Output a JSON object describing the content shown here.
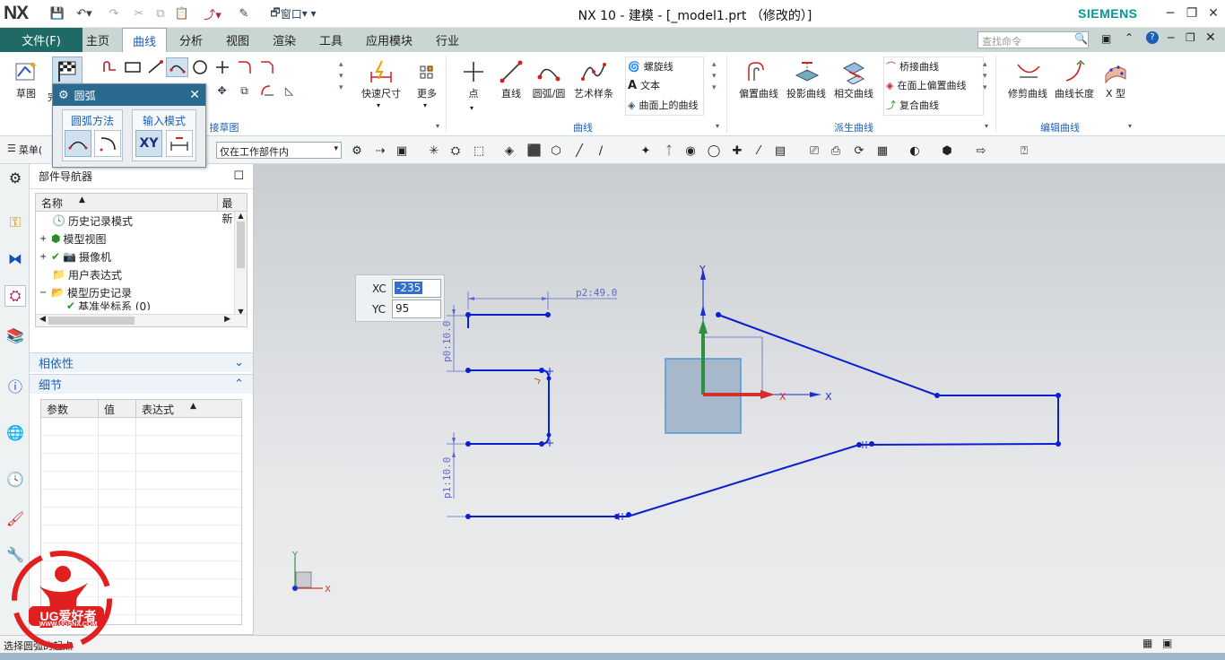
{
  "app": {
    "logo": "NX",
    "window_title": "NX 10 - 建模 - [_model1.prt （修改的）]",
    "brand": "SIEMENS",
    "window_menu": "窗口",
    "accent_color": "#1f6a65",
    "link_color": "#1d5fb5"
  },
  "menu": {
    "file": "文件(F)",
    "tabs": [
      "主页",
      "曲线",
      "分析",
      "视图",
      "渲染",
      "工具",
      "应用模块",
      "行业"
    ],
    "active_tab": "曲线",
    "search_placeholder": "查找命令"
  },
  "ribbon": {
    "sketch": "草图",
    "finish": "完",
    "sketch_group": "接草图",
    "quick_dim": "快速尺寸",
    "more": "更多",
    "point": "点",
    "line": "直线",
    "arc_circle": "圆弧/圆",
    "art_spline": "艺术样条",
    "helix": "螺旋线",
    "text": "文本",
    "curve_on_surface": "曲面上的曲线",
    "curve_group": "曲线",
    "offset_curve": "偏置曲线",
    "project_curve": "投影曲线",
    "intersect_curve": "相交曲线",
    "bridge_curve": "桥接曲线",
    "offset_in_face": "在面上偏置曲线",
    "composite_curve": "复合曲线",
    "derived_group": "派生曲线",
    "trim_curve": "修剪曲线",
    "curve_length": "曲线长度",
    "x_form": "X 型",
    "edit_group": "编辑曲线"
  },
  "secondary": {
    "menu": "菜单(",
    "filter": "仅在工作部件内"
  },
  "arc_dialog": {
    "title": "圆弧",
    "method_label": "圆弧方法",
    "input_label": "输入模式",
    "xy": "XY"
  },
  "navigator": {
    "title": "部件导航器",
    "col_name": "名称",
    "col_latest": "最新",
    "items": [
      "历史记录模式",
      "模型视图",
      "摄像机",
      "用户表达式",
      "模型历史记录",
      "基准坐标系 (0)"
    ],
    "dependency": "相依性",
    "details": "细节",
    "detail_cols": [
      "参数",
      "值",
      "表达式"
    ]
  },
  "canvas": {
    "xc_label": "XC",
    "xc_value": "-235",
    "yc_label": "YC",
    "yc_value": "95",
    "dim_p2": "p2:49.0",
    "dim_p0": "p0:10.0",
    "dim_p1": "p1:10.0",
    "axis_x": "X",
    "axis_y": "Y",
    "sketch_color": "#0a1fd0"
  },
  "status": {
    "prompt": "选择圆弧的起点"
  },
  "watermark": {
    "brand": "UG爱好者",
    "url": "WWW.UGSNX.COM"
  }
}
